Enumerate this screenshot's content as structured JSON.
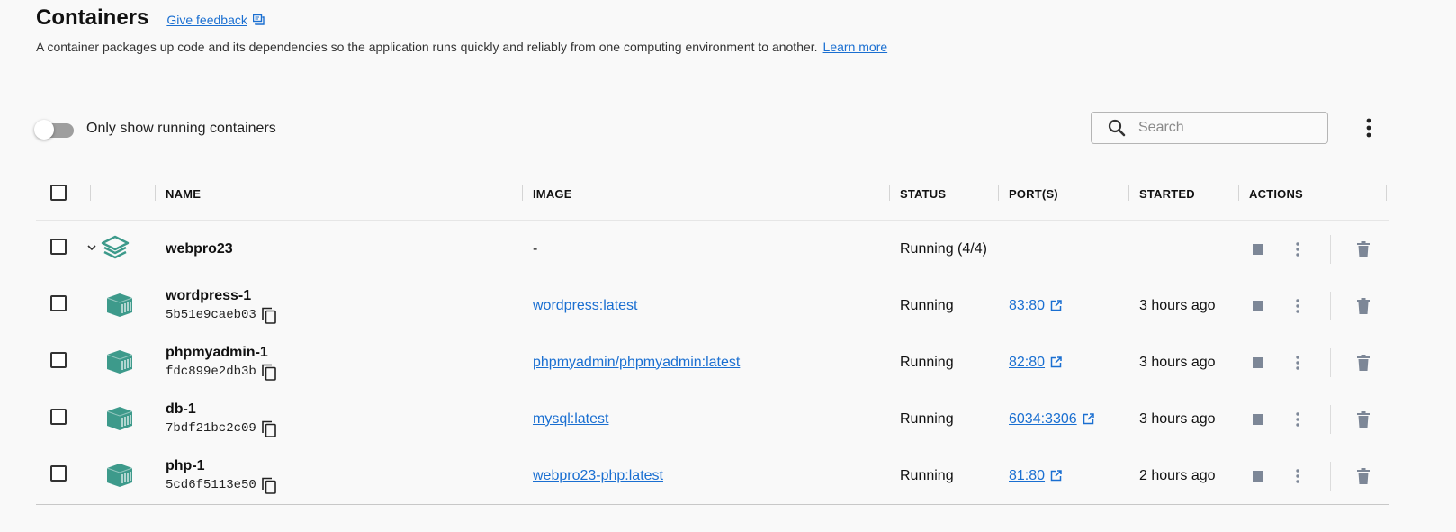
{
  "header": {
    "title": "Containers",
    "feedback_label": "Give feedback",
    "description": "A container packages up code and its dependencies so the application runs quickly and reliably from one computing environment to another.",
    "learn_more": "Learn more"
  },
  "toolbar": {
    "toggle_label": "Only show running containers",
    "toggle_on": false,
    "search_placeholder": "Search",
    "search_value": ""
  },
  "table": {
    "headers": [
      "NAME",
      "IMAGE",
      "STATUS",
      "PORT(S)",
      "STARTED",
      "ACTIONS"
    ],
    "group": {
      "name": "webpro23",
      "image": "-",
      "status": "Running (4/4)",
      "expanded": true
    },
    "rows": [
      {
        "name": "wordpress-1",
        "id": "5b51e9caeb03",
        "image": "wordpress:latest",
        "status": "Running",
        "port": "83:80",
        "started": "3 hours ago"
      },
      {
        "name": "phpmyadmin-1",
        "id": "fdc899e2db3b",
        "image": "phpmyadmin/phpmyadmin:latest",
        "status": "Running",
        "port": "82:80",
        "started": "3 hours ago"
      },
      {
        "name": "db-1",
        "id": "7bdf21bc2c09",
        "image": "mysql:latest",
        "status": "Running",
        "port": "6034:3306",
        "started": "3 hours ago"
      },
      {
        "name": "php-1",
        "id": "5cd6f5113e50",
        "image": "webpro23-php:latest",
        "status": "Running",
        "port": "81:80",
        "started": "2 hours ago"
      }
    ]
  },
  "icons": {
    "feedback": "feedback-icon",
    "search": "search-icon",
    "more": "more-vert-icon",
    "stack": "stack-icon",
    "container": "container-icon",
    "copy": "copy-icon",
    "external": "external-link-icon",
    "stop": "stop-icon",
    "delete": "trash-icon",
    "chevron": "chevron-down-icon"
  },
  "colors": {
    "accent_link": "#1a6fd1",
    "container_icon": "#3d9a8b",
    "action_icon": "#7d8797"
  }
}
